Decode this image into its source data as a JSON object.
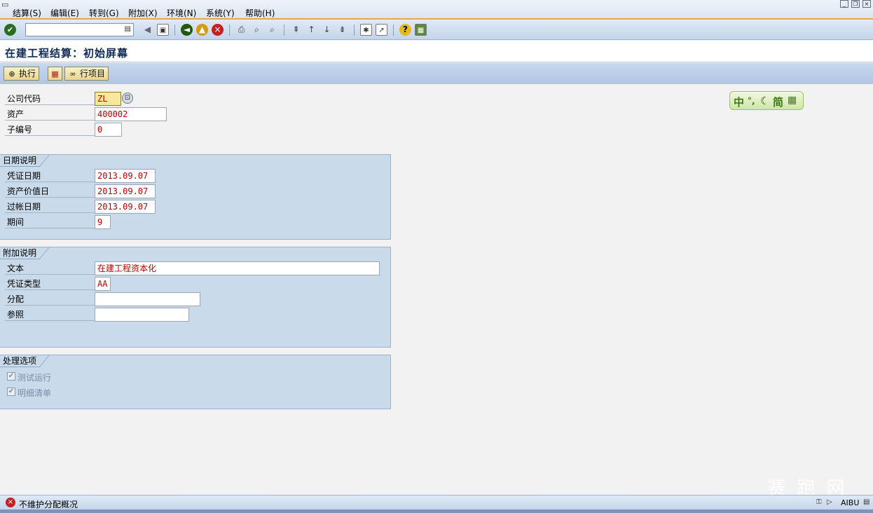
{
  "menu": {
    "items": [
      "结算(S)",
      "编辑(E)",
      "转到(G)",
      "附加(X)",
      "环境(N)",
      "系统(Y)",
      "帮助(H)"
    ]
  },
  "toolbar": {
    "command_value": "",
    "icons": [
      "enter-icon",
      "back-icon",
      "save-icon",
      "back-green-icon",
      "exit-icon",
      "cancel-icon",
      "print-icon",
      "find-icon",
      "find-next-icon",
      "first-page-icon",
      "prev-page-icon",
      "next-page-icon",
      "last-page-icon",
      "new-session-icon",
      "shortcut-icon",
      "help-icon",
      "layout-icon"
    ]
  },
  "title": "在建工程结算：初始屏幕",
  "app_toolbar": {
    "execute_label": "执行",
    "line_items_label": "行项目"
  },
  "header_fields": {
    "company_code_label": "公司代码",
    "company_code_value": "ZL",
    "asset_label": "资产",
    "asset_value": "400002",
    "subnumber_label": "子编号",
    "subnumber_value": "0"
  },
  "date_group": {
    "title": "日期说明",
    "doc_date_label": "凭证日期",
    "doc_date_value": "2013.09.07",
    "value_date_label": "资产价值日",
    "value_date_value": "2013.09.07",
    "posting_date_label": "过帐日期",
    "posting_date_value": "2013.09.07",
    "period_label": "期间",
    "period_value": "9"
  },
  "additional_group": {
    "title": "附加说明",
    "text_label": "文本",
    "text_value": "在建工程资本化",
    "doc_type_label": "凭证类型",
    "doc_type_value": "AA",
    "assignment_label": "分配",
    "assignment_value": "",
    "reference_label": "参照",
    "reference_value": ""
  },
  "processing_group": {
    "title": "处理选项",
    "test_run_label": "测试运行",
    "test_run_checked": true,
    "detail_list_label": "明细清单",
    "detail_list_checked": true
  },
  "ime": {
    "chinese": "中",
    "simplified": "简"
  },
  "status": {
    "message": "不维护分配概况",
    "system": "AIBU"
  },
  "watermark": "赛 跑 网"
}
